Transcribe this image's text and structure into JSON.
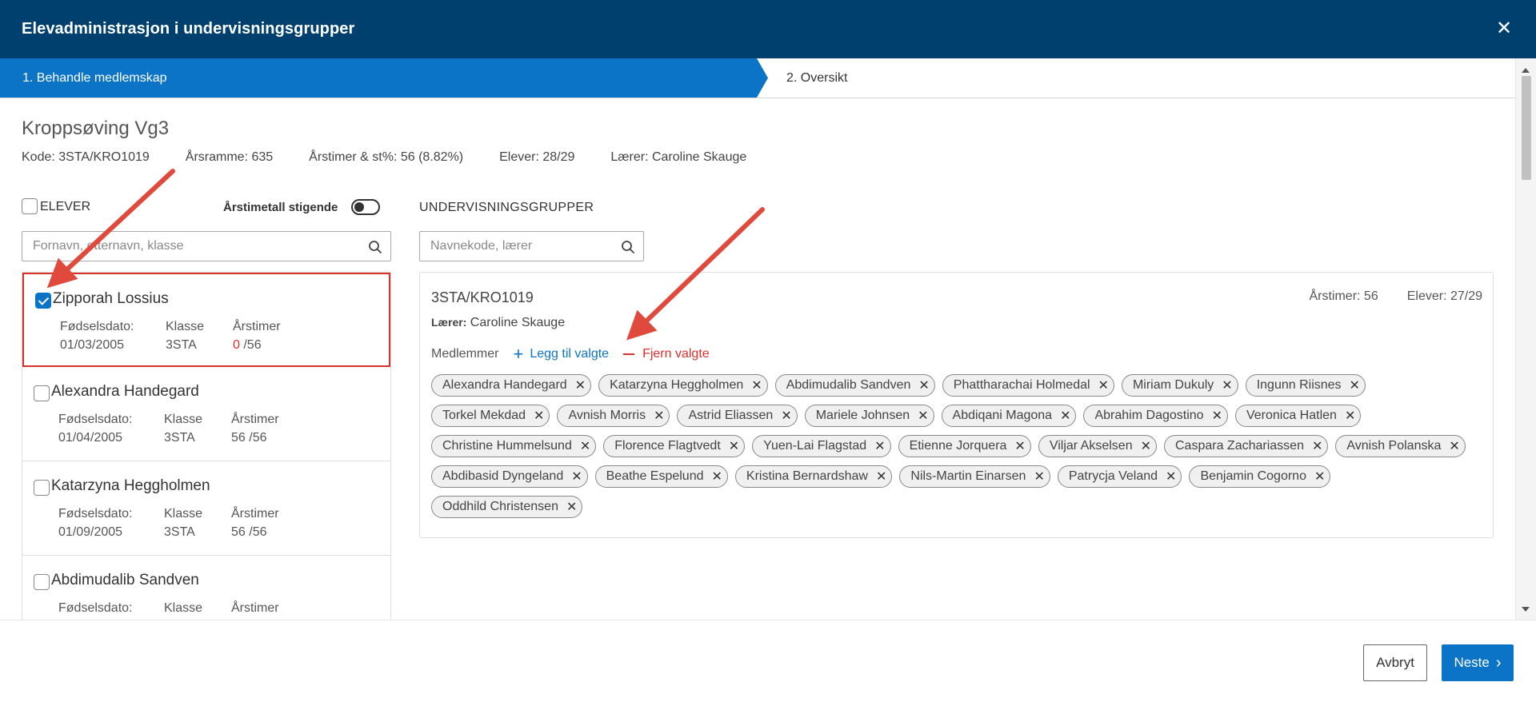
{
  "header": {
    "title": "Elevadministrasjon i undervisningsgrupper",
    "close_icon": "close-icon"
  },
  "steps": [
    {
      "label": "1. Behandle medlemskap",
      "active": true
    },
    {
      "label": "2. Oversikt",
      "active": false
    }
  ],
  "course": {
    "title": "Kroppsøving Vg3",
    "code": "Kode: 3STA/KRO1019",
    "arsramme": "Årsramme: 635",
    "arstimer": "Årstimer & st%: 56 (8.82%)",
    "elever": "Elever: 28/29",
    "laerer": "Lærer: Caroline Skauge"
  },
  "left": {
    "select_all_label": "ELEVER",
    "sort_label": "Årstimetall stigende",
    "search_placeholder": "Fornavn, etternavn, klasse",
    "col_labels": {
      "birth": "Fødselsdato:",
      "class": "Klasse",
      "hours": "Årstimer"
    },
    "students": [
      {
        "name": "Zipporah Lossius",
        "birth": "01/03/2005",
        "class": "3STA",
        "hours": "0",
        "hours_total": " /56",
        "selected": true
      },
      {
        "name": "Alexandra Handegard",
        "birth": "01/04/2005",
        "class": "3STA",
        "hours": "56",
        "hours_total": " /56",
        "selected": false
      },
      {
        "name": "Katarzyna Heggholmen",
        "birth": "01/09/2005",
        "class": "3STA",
        "hours": "56",
        "hours_total": " /56",
        "selected": false
      },
      {
        "name": "Abdimudalib Sandven",
        "birth": "",
        "class": "",
        "hours": "",
        "hours_total": "",
        "selected": false
      }
    ]
  },
  "right": {
    "heading": "UNDERVISNINGSGRUPPER",
    "search_placeholder": "Navnekode, lærer",
    "group": {
      "code": "3STA/KRO1019",
      "arstimer": "Årstimer: 56",
      "elever": "Elever: 27/29",
      "teacher_label": "Lærer:",
      "teacher": " Caroline Skauge",
      "members_label": "Medlemmer",
      "add_label": "Legg til valgte",
      "remove_label": "Fjern valgte",
      "members": [
        "Alexandra Handegard",
        "Katarzyna Heggholmen",
        "Abdimudalib Sandven",
        "Phattharachai Holmedal",
        "Miriam Dukuly",
        "Ingunn Riisnes",
        "Torkel Mekdad",
        "Avnish Morris",
        "Astrid Eliassen",
        "Mariele Johnsen",
        "Abdiqani Magona",
        "Abrahim Dagostino",
        "Veronica Hatlen",
        "Christine Hummelsund",
        "Florence Flagtvedt",
        "Yuen-Lai Flagstad",
        "Etienne Jorquera",
        "Viljar Akselsen",
        "Caspara Zachariassen",
        "Avnish Polanska",
        "Abdibasid Dyngeland",
        "Beathe Espelund",
        "Kristina Bernardshaw",
        "Nils-Martin Einarsen",
        "Patrycja Veland",
        "Benjamin Cogorno",
        "Oddhild Christensen"
      ]
    }
  },
  "footer": {
    "cancel_label": "Avbryt",
    "next_label": "Neste"
  },
  "colors": {
    "header": "#00406e",
    "accent": "#0b74c6",
    "danger": "#d9302c",
    "annotation": "#e04a3c"
  }
}
